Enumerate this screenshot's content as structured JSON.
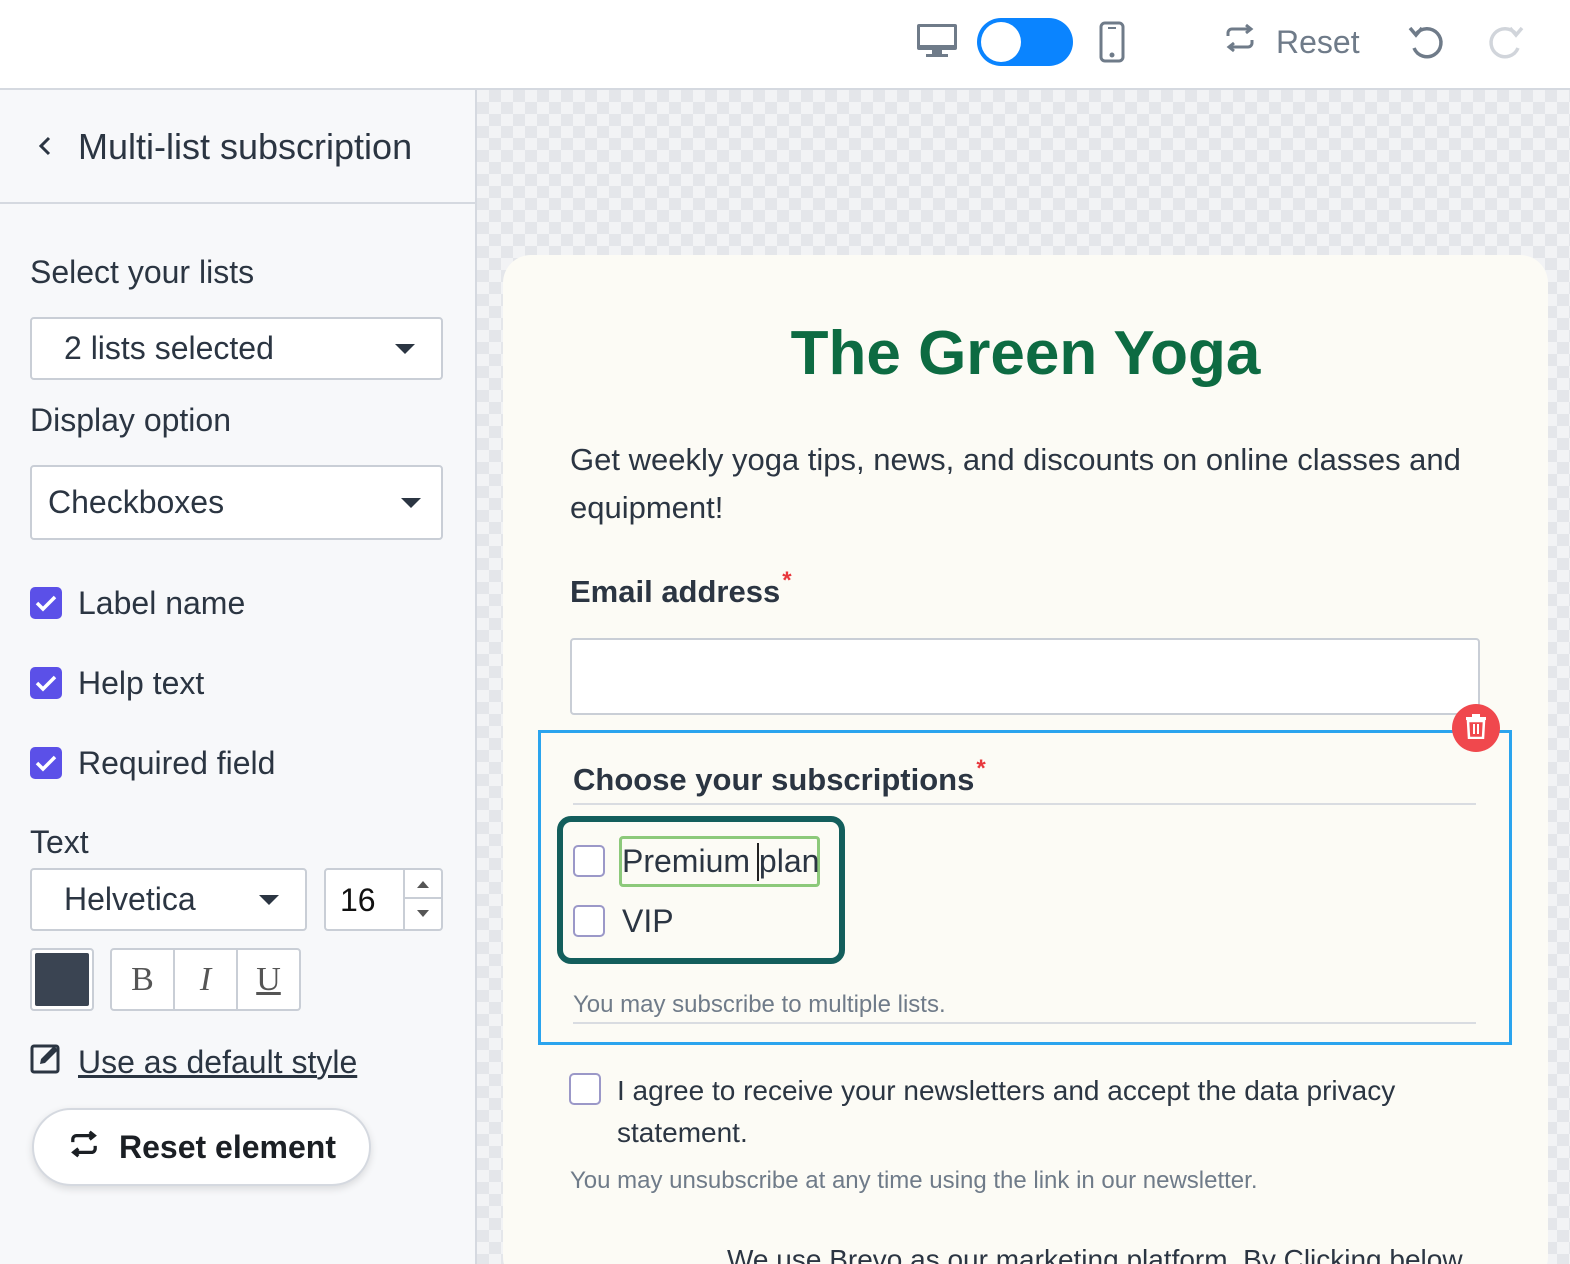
{
  "topbar": {
    "desktop_icon": "desktop-icon",
    "mobile_icon": "mobile-icon",
    "device_toggle_state": "desktop",
    "reset_label": "Reset",
    "undo_icon": "undo-icon",
    "redo_icon": "redo-icon"
  },
  "sidebar": {
    "title": "Multi-list subscription",
    "select_lists_label": "Select your lists",
    "lists_value": "2 lists selected",
    "display_option_label": "Display option",
    "display_option_value": "Checkboxes",
    "checks": [
      {
        "label": "Label name",
        "checked": true
      },
      {
        "label": "Help text",
        "checked": true
      },
      {
        "label": "Required field",
        "checked": true
      }
    ],
    "text_label": "Text",
    "font_value": "Helvetica",
    "font_size": "16",
    "text_color": "#3a4452",
    "format": {
      "bold": "B",
      "italic": "I",
      "underline": "U"
    },
    "default_style_label": "Use as default style",
    "reset_element_label": "Reset element"
  },
  "form": {
    "title": "The Green Yoga",
    "title_color": "#0d6b42",
    "description": "Get weekly yoga tips, news, and discounts on online classes and equipment!",
    "email_label": "Email address",
    "required_mark": "*",
    "subscriptions_label": "Choose your subscriptions",
    "options": [
      {
        "label": "Premium plan",
        "checked": false
      },
      {
        "label": "VIP",
        "checked": false
      }
    ],
    "subscriptions_help": "You may subscribe to multiple lists.",
    "agree_text": "I agree to receive your newsletters and accept the data privacy statement.",
    "unsubscribe_help": "You may unsubscribe at any time using the link in our newsletter.",
    "footer_partial": "We use Brevo as our marketing platform. By Clicking below"
  },
  "colors": {
    "accent": "#5b50e8",
    "toggle": "#0a84ff",
    "selection": "#2aa4ee",
    "delete": "#f0484d"
  }
}
